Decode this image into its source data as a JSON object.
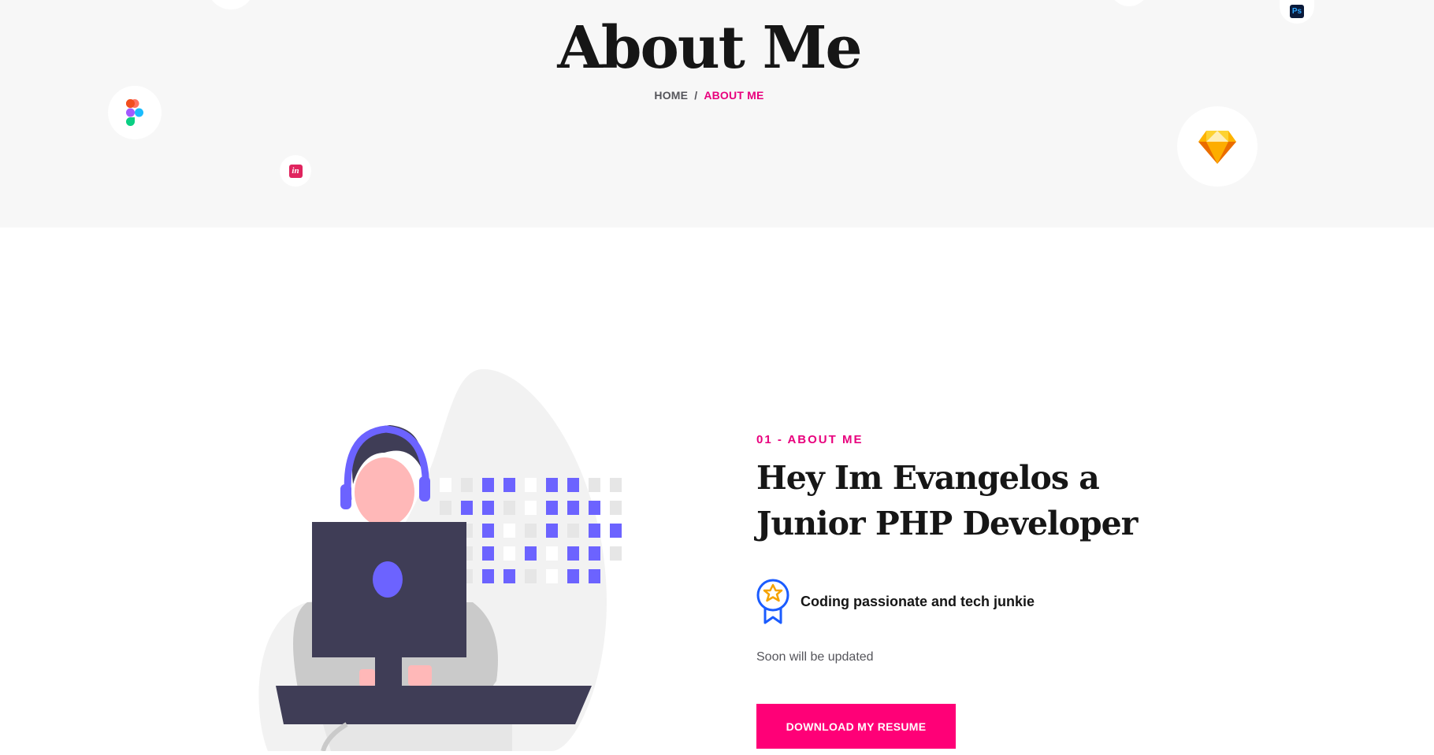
{
  "hero": {
    "title": "About Me",
    "breadcrumb": {
      "home": "HOME",
      "separator": "/",
      "current": "ABOUT ME"
    },
    "floating_icons": [
      "figma-icon",
      "invision-icon",
      "photoshop-icon",
      "sketch-icon"
    ]
  },
  "about": {
    "kicker": "01 - ABOUT ME",
    "heading": "Hey Im Evangelos a Junior PHP Developer",
    "feature": {
      "icon": "award-ribbon-icon",
      "text": "Coding passionate and tech junkie"
    },
    "description": "Soon will be updated",
    "cta_label": "DOWNLOAD MY RESUME"
  },
  "colors": {
    "accent": "#ff0077",
    "accent_text": "#e8007d",
    "hero_bg": "#f7f7f7",
    "illustration_purple": "#6c63ff",
    "illustration_dark": "#3f3d56"
  }
}
